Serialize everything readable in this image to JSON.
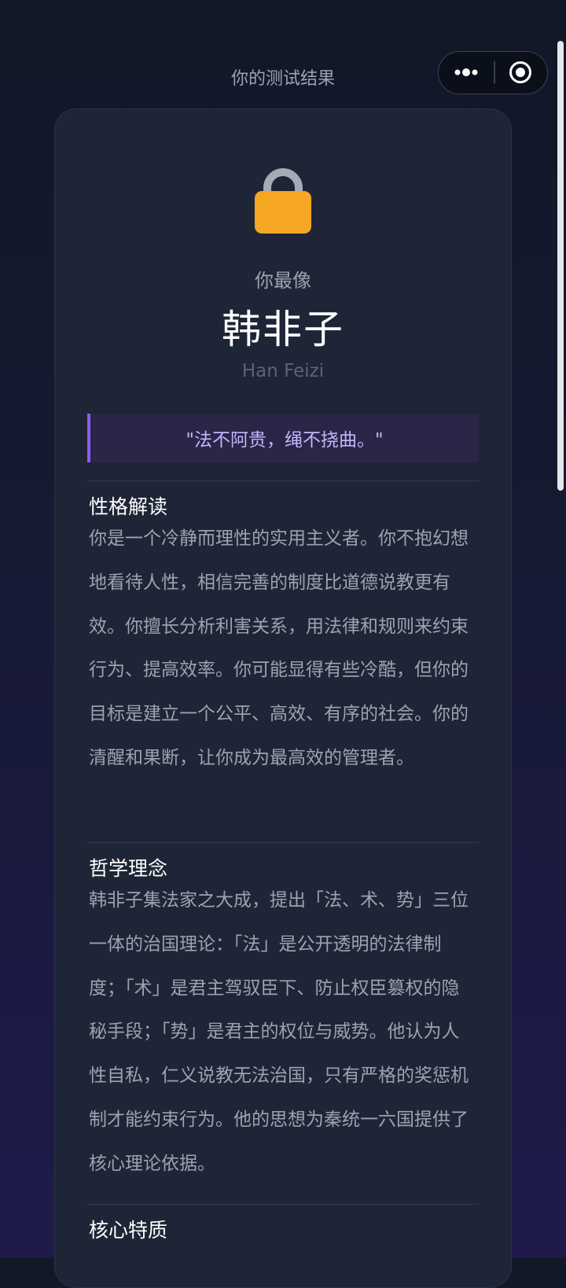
{
  "header": {
    "title": "你的测试结果"
  },
  "capsule": {
    "more_icon": "more-dots-icon",
    "close_icon": "target-close-icon"
  },
  "result": {
    "lock_icon": "lock-icon",
    "subtitle": "你最像",
    "name": "韩非子",
    "english_name": "Han Feizi",
    "quote": "\"法不阿贵，绳不挠曲。\""
  },
  "sections": [
    {
      "title": "性格解读",
      "body": "你是一个冷静而理性的实用主义者。你不抱幻想地看待人性，相信完善的制度比道德说教更有效。你擅长分析利害关系，用法律和规则来约束行为、提高效率。你可能显得有些冷酷，但你的目标是建立一个公平、高效、有序的社会。你的清醒和果断，让你成为最高效的管理者。"
    },
    {
      "title": "哲学理念",
      "body": "韩非子集法家之大成，提出「法、术、势」三位一体的治国理论：「法」是公开透明的法律制度；「术」是君主驾驭臣下、防止权臣篡权的隐秘手段；「势」是君主的权位与威势。他认为人性自私，仁义说教无法治国，只有严格的奖惩机制才能约束行为。他的思想为秦统一六国提供了核心理论依据。"
    },
    {
      "title": "核心特质",
      "body": ""
    }
  ],
  "colors": {
    "accent_purple": "#8b5cf6",
    "quote_text": "#c4b5fd",
    "lock_body": "#f5a623",
    "lock_shackle": "#a3acb5"
  }
}
